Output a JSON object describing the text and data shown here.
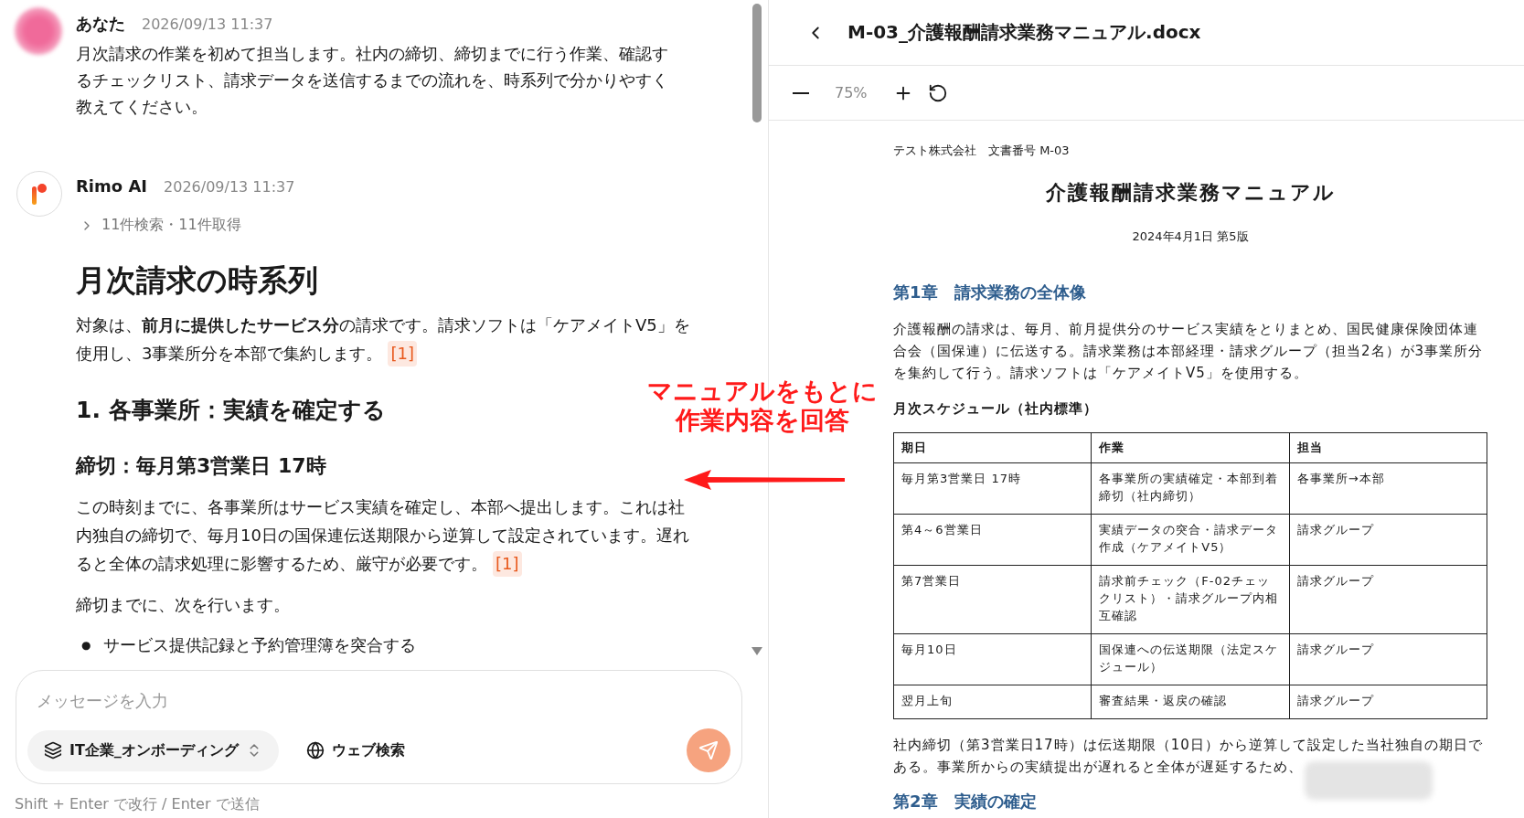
{
  "chat": {
    "messages": [
      {
        "kind": "user",
        "author": "あなた",
        "time": "2026/09/13 11:37",
        "text": "月次請求の作業を初めて担当します。社内の締切、締切までに行う作業、確認するチェックリスト、請求データを送信するまでの流れを、時系列で分かりやすく教えてください。"
      },
      {
        "kind": "assistant",
        "author": "Rimo AI",
        "time": "2026/09/13 11:37",
        "sources": "11件検索・11件取得",
        "blocks": [
          {
            "kind": "h1",
            "text": "月次請求の時系列"
          },
          {
            "kind": "p",
            "text": "対象は、**前月に提供したサービス分**の請求です。請求ソフトは「ケアメイトV5」を使用し、3事業所分を本部で集約します。",
            "cite": "[1]"
          },
          {
            "kind": "h2",
            "text": "1. 各事業所：実績を確定する"
          },
          {
            "kind": "h3",
            "text": "締切：毎月第3営業日 17時"
          },
          {
            "kind": "p",
            "text": "この時刻までに、各事業所はサービス実績を確定し、本部へ提出します。これは社内独自の締切で、毎月10日の国保連伝送期限から逆算して設定されています。遅れると全体の請求処理に影響するため、厳守が必要です。",
            "cite": "[1]"
          },
          {
            "kind": "p",
            "text": "締切までに、次を行います。"
          },
          {
            "kind": "bullet",
            "marker": "●",
            "text": "サービス提供記録と予約管理簿を突合する"
          }
        ]
      }
    ]
  },
  "composer": {
    "placeholder": "メッセージを入力",
    "knowledge": "IT企業_オンボーディング",
    "web_search": "ウェブ検索",
    "hint": "Shift + Enter で改行 / Enter で送信"
  },
  "viewer": {
    "title": "M-03_介護報酬請求業務マニュアル.docx",
    "zoom": "75%",
    "document": [
      {
        "kind": "meta",
        "text": "テスト株式会社　文書番号 M-03"
      },
      {
        "kind": "title",
        "text": "介護報酬請求業務マニュアル"
      },
      {
        "kind": "date",
        "text": "2024年4月1日 第5版"
      },
      {
        "kind": "chapter",
        "text": "第1章　請求業務の全体像"
      },
      {
        "kind": "p",
        "text": "介護報酬の請求は、毎月、前月提供分のサービス実績をとりまとめ、国民健康保険団体連合会（国保連）に伝送する。請求業務は本部経理・請求グループ（担当2名）が3事業所分を集約して行う。請求ソフトは「ケアメイトV5」を使用する。"
      },
      {
        "kind": "label",
        "text": "月次スケジュール（社内標準）"
      },
      {
        "kind": "table",
        "columns": [
          "期日",
          "作業",
          "担当"
        ],
        "rows": [
          [
            "毎月第3営業日 17時",
            "各事業所の実績確定・本部到着締切（社内締切）",
            "各事業所→本部"
          ],
          [
            "第4～6営業日",
            "実績データの突合・請求データ作成（ケアメイトV5）",
            "請求グループ"
          ],
          [
            "第7営業日",
            "請求前チェック（F-02チェックリスト）・請求グループ内相互確認",
            "請求グループ"
          ],
          [
            "毎月10日",
            "国保連への伝送期限（法定スケジュール）",
            "請求グループ"
          ],
          [
            "翌月上旬",
            "審査結果・返戻の確認",
            "請求グループ"
          ]
        ]
      },
      {
        "kind": "covered",
        "text": "社内締切（第3営業日17時）は伝送期限（10日）から逆算して設定した当社独自の期日である。事業所からの実績提出が遅れると全体が遅延するため、"
      },
      {
        "kind": "chapter",
        "text": "第2章　実績の確定"
      }
    ]
  },
  "annotation": {
    "lines": [
      "マニュアルをもとに",
      "作業内容を回答"
    ]
  }
}
